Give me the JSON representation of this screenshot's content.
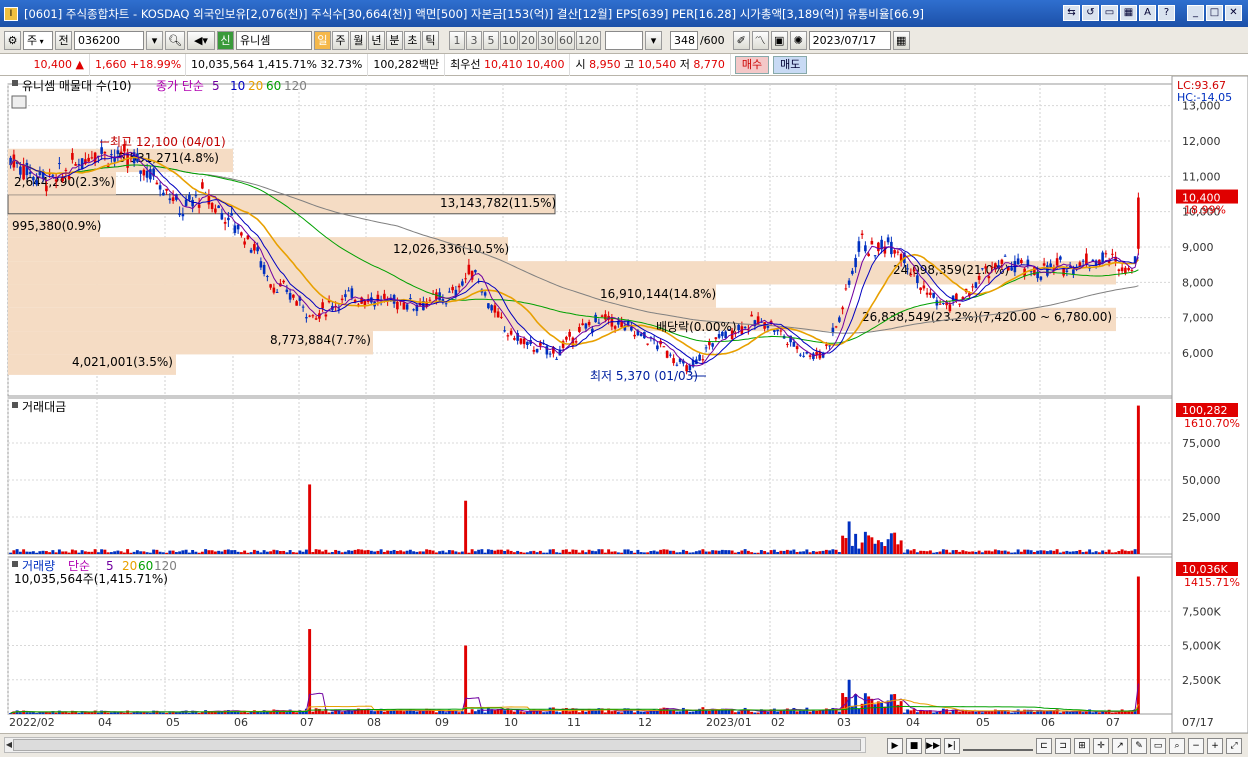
{
  "window": {
    "title": "[0601] 주식종합차트 - KOSDAQ 외국인보유[2,076(천)] 주식수[30,664(천)] 액면[500] 자본금[153(억)] 결산[12월] EPS[639] PER[16.28] 시가총액[3,189(억)] 유통비율[66.9]",
    "icon": "app-icon"
  },
  "toolbar": {
    "period_mode": "주",
    "prefix": "전",
    "code": "036200",
    "stock_badge": "신",
    "stock_name": "유니셈",
    "periods": [
      "일",
      "주",
      "월",
      "년",
      "분",
      "초",
      "틱"
    ],
    "active_period": "일",
    "intervals": [
      "1",
      "3",
      "5",
      "10",
      "20",
      "30",
      "60",
      "120"
    ],
    "count": "348",
    "count_total": "/600",
    "date": "2023/07/17"
  },
  "quote": {
    "price": "10,400",
    "price_arrow": "▲",
    "change": "1,660",
    "change_pct": "+18.99%",
    "volume": "10,035,564",
    "volume_pct": "1,415.71%",
    "ratio": "32.73%",
    "amount": "100,282백만",
    "best_label": "최우선",
    "best_ask": "10,410",
    "best_bid": "10,400",
    "open_label": "시",
    "open": "8,950",
    "high_label": "고",
    "high": "10,540",
    "low_label": "저",
    "low": "8,770",
    "buy": "매수",
    "sell": "매도"
  },
  "price_panel": {
    "legend_name": "유니셈 매물대 수(10)",
    "ma_label": "종가 단순",
    "ma_periods": [
      "5",
      "10",
      "20",
      "60",
      "120"
    ],
    "lc": "LC:93.67",
    "hc": "HC:-14.05",
    "y_ticks": [
      "13,000",
      "12,000",
      "11,000",
      "10,000",
      "9,000",
      "8,000",
      "7,000",
      "6,000"
    ],
    "last_price": "10,400",
    "last_pct": "18.99%",
    "high_note": "최고 12,100 (04/01)",
    "low_note": "최저 5,370 (01/03)",
    "vp_labels": [
      "4,021,001(3.5%)",
      "8,773,884(7.7%)",
      "26,838,549(23.2%)(7,420.00 ~ 6,780.00)",
      "16,910,144(14.8%)",
      "24,098,359(21.0%)",
      "12,026,336(10.5%)",
      "995,380(0.9%)",
      "13,143,782(11.5%)",
      "2,644,290(2.3%)",
      "5,531,271(4.8%)"
    ],
    "misc_note": "배당락(0.00%)"
  },
  "amount_panel": {
    "legend": "거래대금",
    "y_ticks": [
      "75,000",
      "50,000",
      "25,000"
    ],
    "last_value": "100,282",
    "last_pct": "1610.70%"
  },
  "volume_panel": {
    "legend_name": "거래량",
    "ma_label": "단순",
    "ma_periods": [
      "5",
      "20",
      "60",
      "120"
    ],
    "sub": "10,035,564주(1,415.71%)",
    "y_ticks": [
      "7,500K",
      "5,000K",
      "2,500K"
    ],
    "last_value": "10,036K",
    "last_pct": "1415.71%"
  },
  "x_axis": [
    "2022/02",
    "04",
    "05",
    "06",
    "07",
    "08",
    "09",
    "10",
    "11",
    "12",
    "2023/01",
    "02",
    "03",
    "04",
    "05",
    "06",
    "07"
  ],
  "x_axis_right": "07/17",
  "colors": {
    "up": "#e00000",
    "down": "#0030c0",
    "ma5": "#7000a0",
    "ma10": "#0000c0",
    "ma20": "#e8a000",
    "ma60": "#00a000",
    "ma120": "#808080",
    "volume_profile": "#f5dcc4"
  }
}
